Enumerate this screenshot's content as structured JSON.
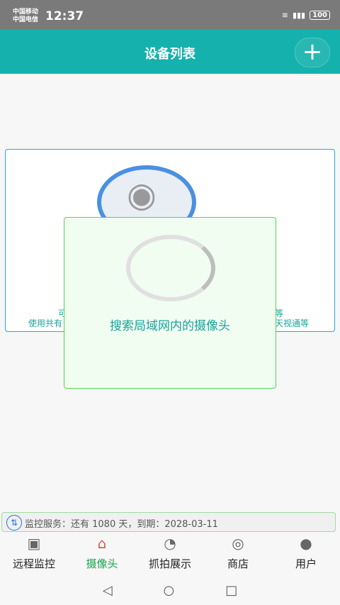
{
  "status_bar": {
    "carrier_1": "中国移动",
    "carrier_2": "中国电信",
    "time": "12:37",
    "battery": "100"
  },
  "header": {
    "title": "设备列表"
  },
  "card": {
    "line_left_1": "可",
    "line_left_2": "使用共有",
    "line_right_1": "等",
    "line_right_2": "天视通等"
  },
  "dialog": {
    "message": "搜索局域网内的摄像头"
  },
  "service": {
    "text": "监控服务：还有 1080 天，到期：2028-03-11"
  },
  "nav": {
    "items": [
      {
        "label": "远程监控",
        "icon": "monitor-icon"
      },
      {
        "label": "摄像头",
        "icon": "house-icon"
      },
      {
        "label": "抓拍展示",
        "icon": "camera-icon"
      },
      {
        "label": "商店",
        "icon": "cart-icon"
      },
      {
        "label": "用户",
        "icon": "user-icon"
      }
    ],
    "active_index": 1
  },
  "colors": {
    "accent": "#15b2ad",
    "nav_active": "#16a64a"
  }
}
